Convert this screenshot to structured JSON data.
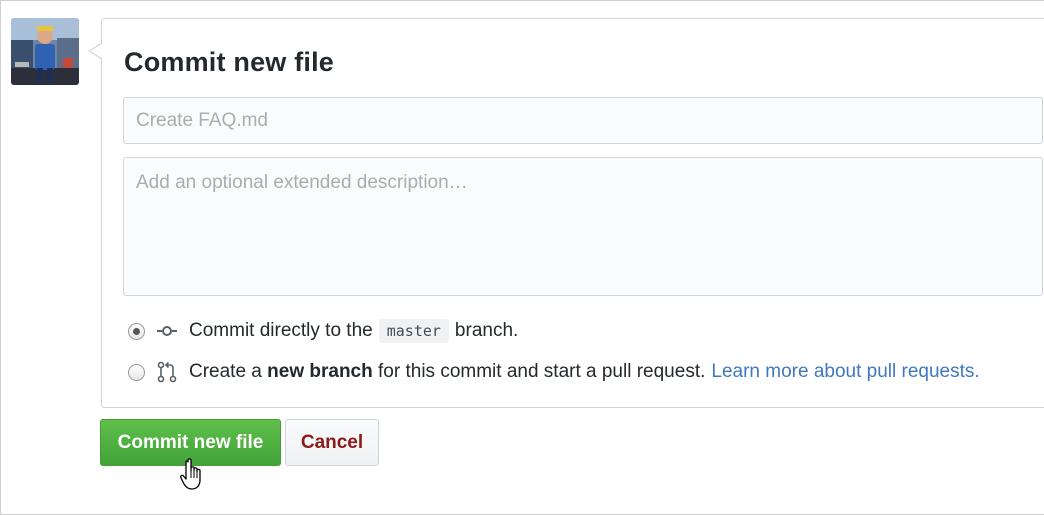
{
  "form": {
    "title": "Commit new file",
    "summary_placeholder": "Create FAQ.md",
    "summary_value": "",
    "description_placeholder": "Add an optional extended description…",
    "description_value": ""
  },
  "commit_options": {
    "selected": "direct",
    "direct": {
      "icon": "git-commit-icon",
      "prefix": "Commit directly to the",
      "branch": "master",
      "suffix": "branch."
    },
    "new_branch": {
      "icon": "git-pull-request-icon",
      "prefix": "Create a",
      "emphasis": "new branch",
      "suffix": "for this commit and start a pull request.",
      "link_text": "Learn more about pull requests."
    }
  },
  "actions": {
    "commit_label": "Commit new file",
    "cancel_label": "Cancel"
  },
  "colors": {
    "primary_button": "#41a33a",
    "cancel_text": "#8b1a1a",
    "link": "#4078c0"
  }
}
